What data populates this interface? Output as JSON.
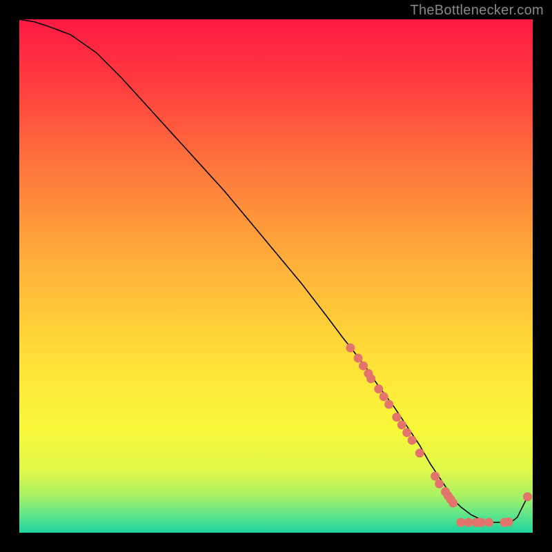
{
  "watermark": "TheBottlenecker.com",
  "chart_data": {
    "type": "line",
    "title": "",
    "xlabel": "",
    "ylabel": "",
    "xlim": [
      0,
      100
    ],
    "ylim": [
      0,
      100
    ],
    "gradient_stops": [
      {
        "pct": 0.0,
        "color": "#ff1a44"
      },
      {
        "pct": 0.12,
        "color": "#ff3a3f"
      },
      {
        "pct": 0.3,
        "color": "#ff7a3c"
      },
      {
        "pct": 0.5,
        "color": "#ffb739"
      },
      {
        "pct": 0.68,
        "color": "#ffe438"
      },
      {
        "pct": 0.8,
        "color": "#f8f83a"
      },
      {
        "pct": 0.88,
        "color": "#dff74a"
      },
      {
        "pct": 0.93,
        "color": "#a4f165"
      },
      {
        "pct": 0.965,
        "color": "#5fe58a"
      },
      {
        "pct": 1.0,
        "color": "#1fd3a0"
      }
    ],
    "series": [
      {
        "name": "bottleneck-curve",
        "x": [
          0,
          3,
          6,
          10,
          15,
          20,
          25,
          30,
          35,
          40,
          45,
          50,
          55,
          60,
          63,
          65,
          68,
          70,
          73,
          76,
          78,
          80,
          82,
          84,
          85,
          86,
          88,
          90,
          92,
          94,
          96,
          97,
          98,
          99
        ],
        "y": [
          100,
          99.5,
          98.5,
          97,
          93.5,
          88.5,
          83,
          77.5,
          72,
          66.5,
          60.5,
          54.5,
          48.5,
          42,
          38,
          35.5,
          31.5,
          28.5,
          24.5,
          20,
          17,
          13.5,
          10.5,
          7.5,
          6,
          5,
          3.5,
          2.5,
          2,
          2,
          2.2,
          3,
          5,
          7
        ]
      }
    ],
    "markers": [
      {
        "x": 64.5,
        "y": 36.0
      },
      {
        "x": 66.0,
        "y": 34.0
      },
      {
        "x": 67.0,
        "y": 32.5
      },
      {
        "x": 68.0,
        "y": 31.0
      },
      {
        "x": 68.5,
        "y": 30.0
      },
      {
        "x": 70.0,
        "y": 28.0
      },
      {
        "x": 71.0,
        "y": 26.5
      },
      {
        "x": 72.0,
        "y": 25.0
      },
      {
        "x": 73.5,
        "y": 22.5
      },
      {
        "x": 74.5,
        "y": 21.0
      },
      {
        "x": 75.5,
        "y": 19.5
      },
      {
        "x": 76.5,
        "y": 18.0
      },
      {
        "x": 78.0,
        "y": 15.5
      },
      {
        "x": 81.0,
        "y": 11.0
      },
      {
        "x": 81.8,
        "y": 9.5
      },
      {
        "x": 83.0,
        "y": 8.0
      },
      {
        "x": 83.5,
        "y": 7.2
      },
      {
        "x": 84.0,
        "y": 6.5
      },
      {
        "x": 84.5,
        "y": 5.8
      },
      {
        "x": 86.0,
        "y": 2.0
      },
      {
        "x": 87.5,
        "y": 2.0
      },
      {
        "x": 89.0,
        "y": 2.0
      },
      {
        "x": 89.5,
        "y": 2.0
      },
      {
        "x": 90.0,
        "y": 2.0
      },
      {
        "x": 91.5,
        "y": 2.0
      },
      {
        "x": 94.5,
        "y": 2.0
      },
      {
        "x": 95.3,
        "y": 2.1
      },
      {
        "x": 99.0,
        "y": 7.0
      }
    ],
    "marker_color": "#e2746c",
    "marker_radius": 6.5
  }
}
